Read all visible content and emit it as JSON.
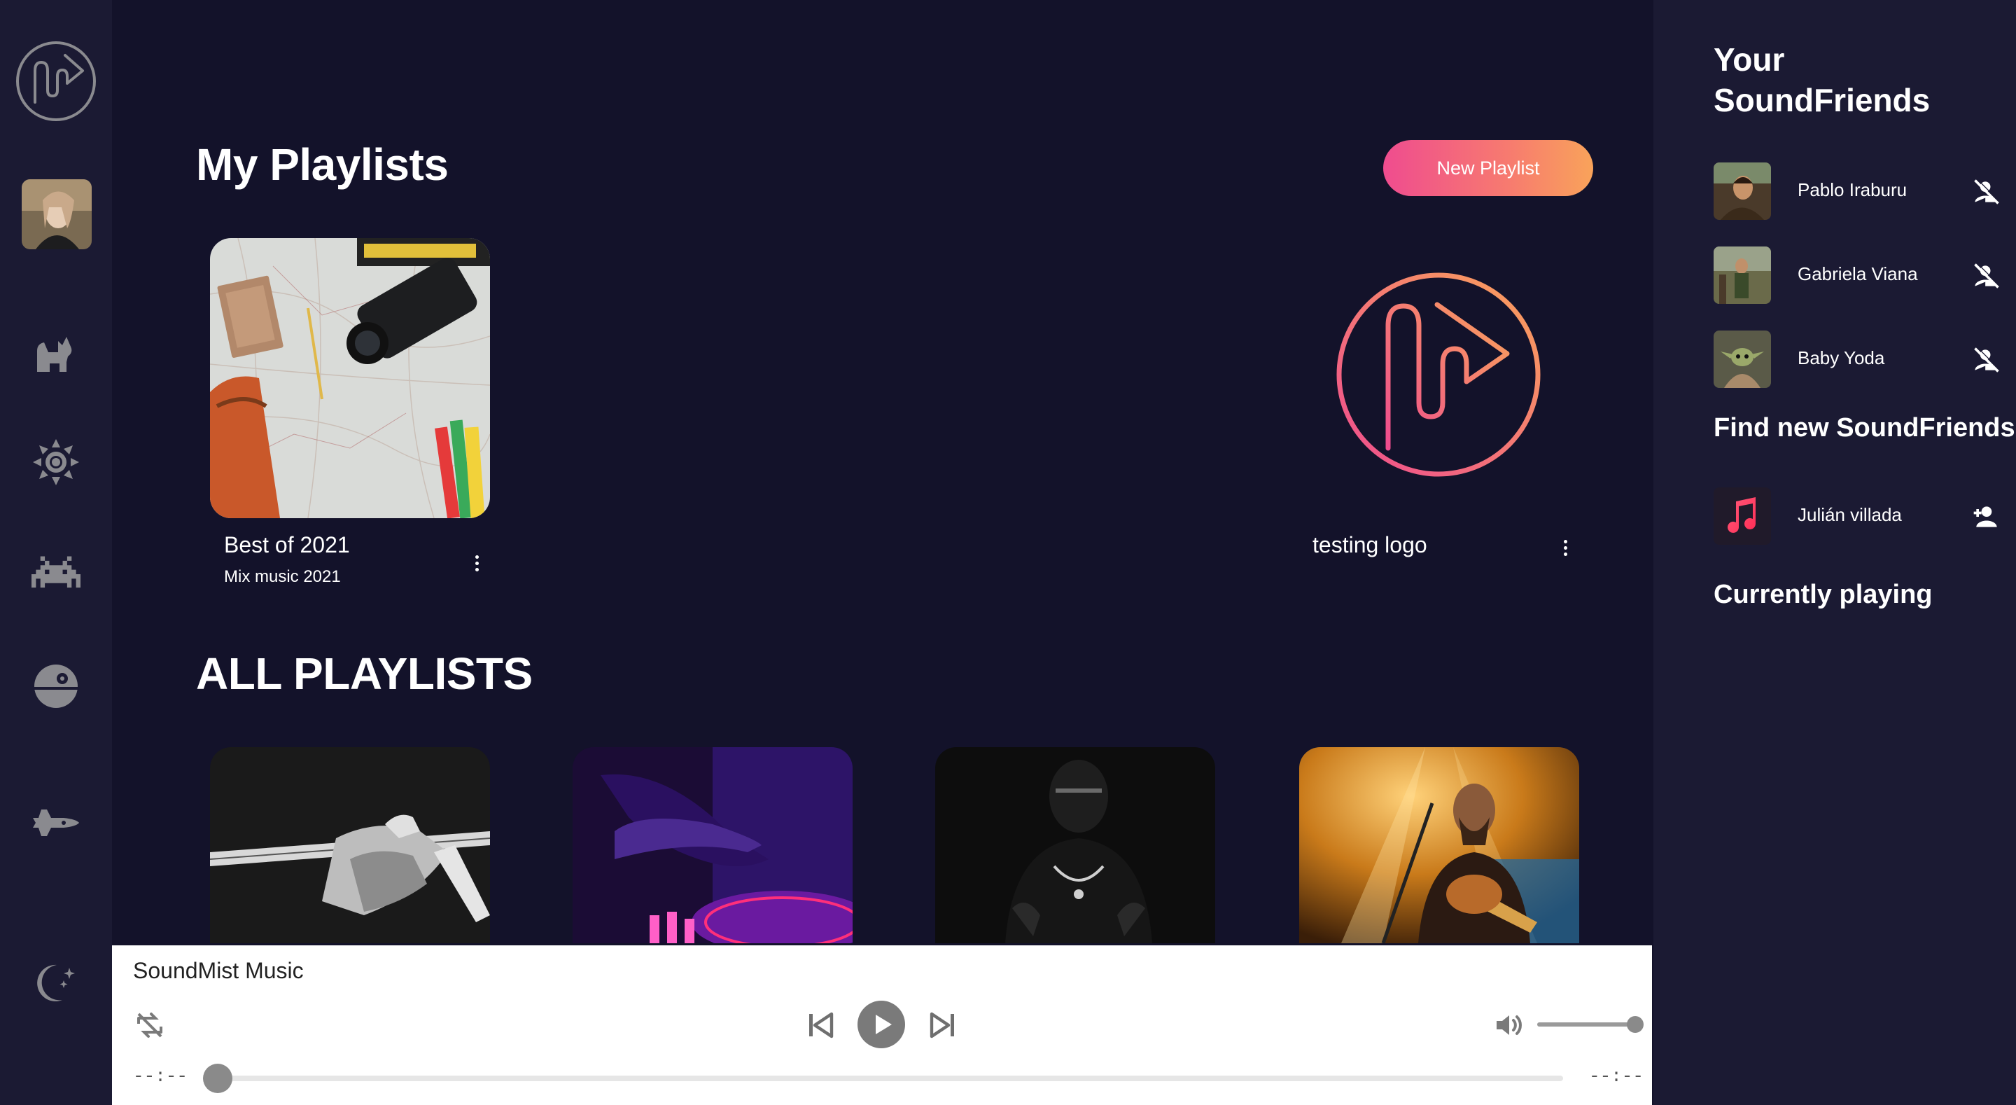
{
  "sidebar": {
    "items": [
      {
        "icon": "app-logo-icon"
      },
      {
        "icon": "user-avatar"
      },
      {
        "icon": "cat-icon"
      },
      {
        "icon": "sun-icon"
      },
      {
        "icon": "space-invader-icon"
      },
      {
        "icon": "death-star-icon"
      },
      {
        "icon": "spaceship-icon"
      },
      {
        "icon": "moon-stars-icon"
      }
    ]
  },
  "main": {
    "my_playlists_title": "My Playlists",
    "new_playlist_label": "New Playlist",
    "my_playlists": [
      {
        "name": "Best of 2021",
        "subtitle": "Mix music 2021",
        "image": "map-travel-photo"
      },
      {
        "name": "testing logo",
        "subtitle": "",
        "image": "soundmist-logo"
      }
    ],
    "all_playlists_title": "ALL PLAYLISTS",
    "all_playlists": [
      {
        "image": "bw-guitar-photo"
      },
      {
        "image": "dj-turntable-purple-photo"
      },
      {
        "image": "dark-portrait-photo"
      },
      {
        "image": "guitarist-stage-lights-photo"
      }
    ]
  },
  "right_panel": {
    "friends_title_line1": "Your",
    "friends_title_line2": "SoundFriends",
    "friends": [
      {
        "name": "Pablo Iraburu",
        "action_icon": "remove-friend-icon"
      },
      {
        "name": "Gabriela Viana",
        "action_icon": "remove-friend-icon"
      },
      {
        "name": "Baby Yoda",
        "action_icon": "remove-friend-icon"
      }
    ],
    "find_title": "Find new SoundFriends",
    "suggestions": [
      {
        "name": "Julián villada",
        "action_icon": "add-friend-icon"
      }
    ],
    "currently_playing_title": "Currently playing"
  },
  "player": {
    "title": "SoundMist Music",
    "elapsed": "--:--",
    "remaining": "--:--",
    "progress_fraction": 0,
    "volume_fraction": 1
  },
  "colors": {
    "background": "#13122a",
    "panel": "#1b1a33",
    "accent_start": "#ef4c8f",
    "accent_end": "#f9a35a",
    "icon_gray": "#8a8a8f"
  }
}
